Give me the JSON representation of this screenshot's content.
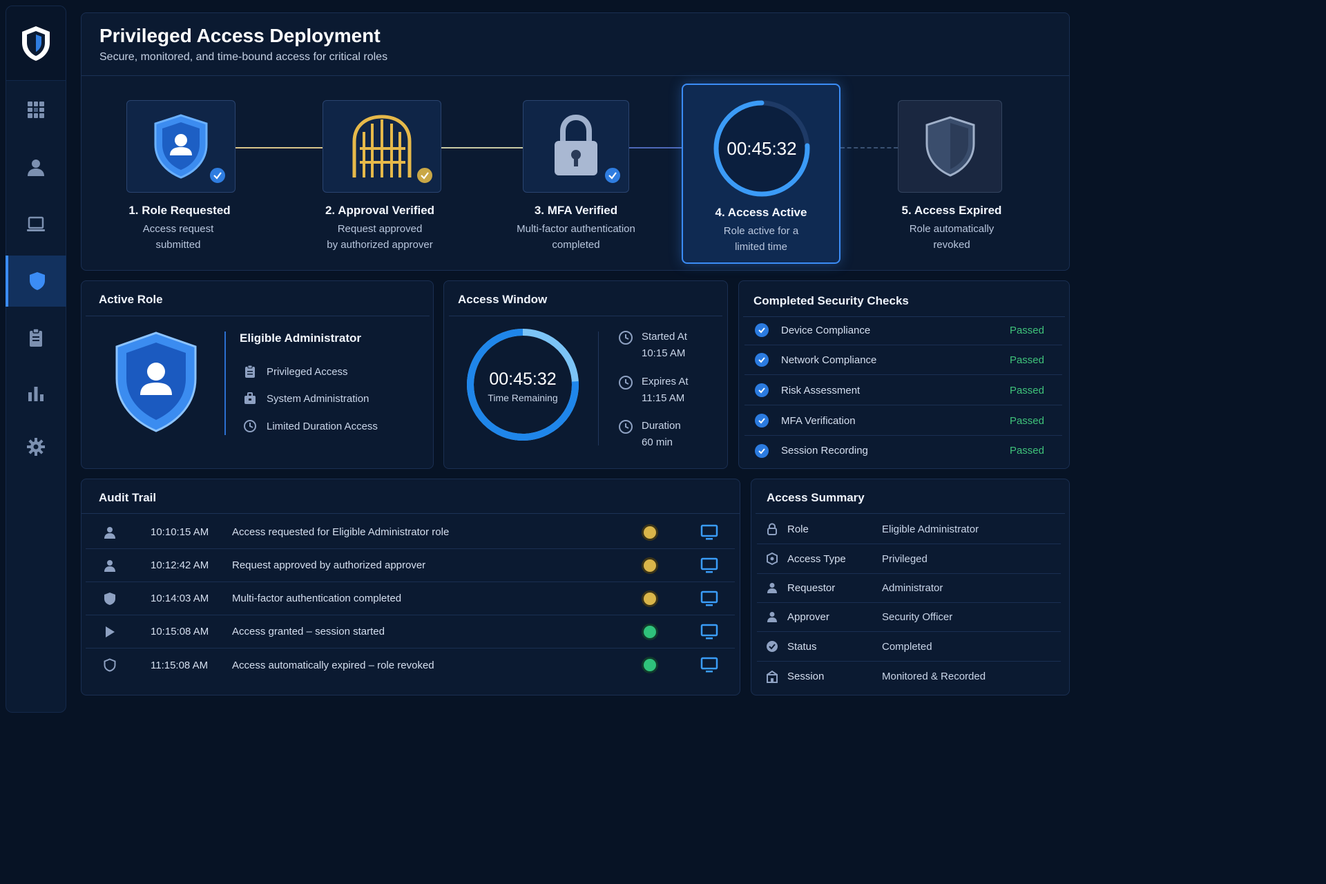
{
  "header": {
    "title": "Privileged Access Deployment",
    "subtitle": "Secure, monitored, and time-bound access for critical roles"
  },
  "sidebar": {
    "items": [
      {
        "icon": "dashboard-icon"
      },
      {
        "icon": "user-icon"
      },
      {
        "icon": "laptop-icon"
      },
      {
        "icon": "shield-icon",
        "active": true
      },
      {
        "icon": "clipboard-icon"
      },
      {
        "icon": "bar-chart-icon"
      },
      {
        "icon": "gear-icon"
      }
    ]
  },
  "steps": [
    {
      "title": "1. Role Requested",
      "desc1": "Access request",
      "desc2": "submitted",
      "status": "done"
    },
    {
      "title": "2. Approval Verified",
      "desc1": "Request approved",
      "desc2": "by authorized approver",
      "status": "done"
    },
    {
      "title": "3. MFA Verified",
      "desc1": "Multi-factor authentication",
      "desc2": "completed",
      "status": "done"
    },
    {
      "title": "4. Access Active",
      "desc1": "Role active for a",
      "desc2": "limited time",
      "timer": "00:45:32",
      "status": "active"
    },
    {
      "title": "5. Access Expired",
      "desc1": "Role automatically",
      "desc2": "revoked",
      "status": "pending"
    }
  ],
  "active_role": {
    "title": "Active Role",
    "role_name": "Eligible Administrator",
    "items": [
      "Privileged Access",
      "System Administration",
      "Limited Duration Access"
    ]
  },
  "access_window": {
    "title": "Access Window",
    "timer": "00:45:32",
    "timer_label": "Time Remaining",
    "remaining_fraction": 0.76,
    "started_label": "Started At",
    "started_value": "10:15 AM",
    "expires_label": "Expires At",
    "expires_value": "11:15 AM",
    "duration_label": "Duration",
    "duration_value": "60 min"
  },
  "security_checks": {
    "title": "Completed Security Checks",
    "items": [
      {
        "name": "Device Compliance",
        "status": "Passed"
      },
      {
        "name": "Network Compliance",
        "status": "Passed"
      },
      {
        "name": "Risk Assessment",
        "status": "Passed"
      },
      {
        "name": "MFA Verification",
        "status": "Passed"
      },
      {
        "name": "Session Recording",
        "status": "Passed"
      }
    ]
  },
  "audit_trail": {
    "title": "Audit Trail",
    "rows": [
      {
        "icon": "user-icon",
        "time": "10:10:15 AM",
        "event": "Access requested for Eligible Administrator role",
        "dot": "#d9b54a"
      },
      {
        "icon": "user-icon",
        "time": "10:12:42 AM",
        "event": "Request approved by authorized approver",
        "dot": "#d9b54a"
      },
      {
        "icon": "shield-icon",
        "time": "10:14:03 AM",
        "event": "Multi-factor authentication completed",
        "dot": "#d9b54a"
      },
      {
        "icon": "play-icon",
        "time": "10:15:08 AM",
        "event": "Access granted – session started",
        "dot": "#2fc27b"
      },
      {
        "icon": "shield-outline-icon",
        "time": "11:15:08 AM",
        "event": "Access automatically expired – role revoked",
        "dot": "#2fc27b"
      }
    ]
  },
  "access_summary": {
    "title": "Access Summary",
    "rows": [
      {
        "icon": "lock-icon",
        "key": "Role",
        "value": "Eligible Administrator"
      },
      {
        "icon": "badge-icon",
        "key": "Access Type",
        "value": "Privileged"
      },
      {
        "icon": "user-icon",
        "key": "Requestor",
        "value": "Administrator"
      },
      {
        "icon": "user-icon",
        "key": "Approver",
        "value": "Security Officer"
      },
      {
        "icon": "check-circle-icon",
        "key": "Status",
        "value": "Completed"
      },
      {
        "icon": "building-icon",
        "key": "Session",
        "value": "Monitored & Recorded"
      }
    ]
  },
  "colors": {
    "accent": "#3b8cf5",
    "gold": "#d9b54a",
    "success": "#3fc27a",
    "background": "#071325",
    "panel": "#0b1a31"
  }
}
